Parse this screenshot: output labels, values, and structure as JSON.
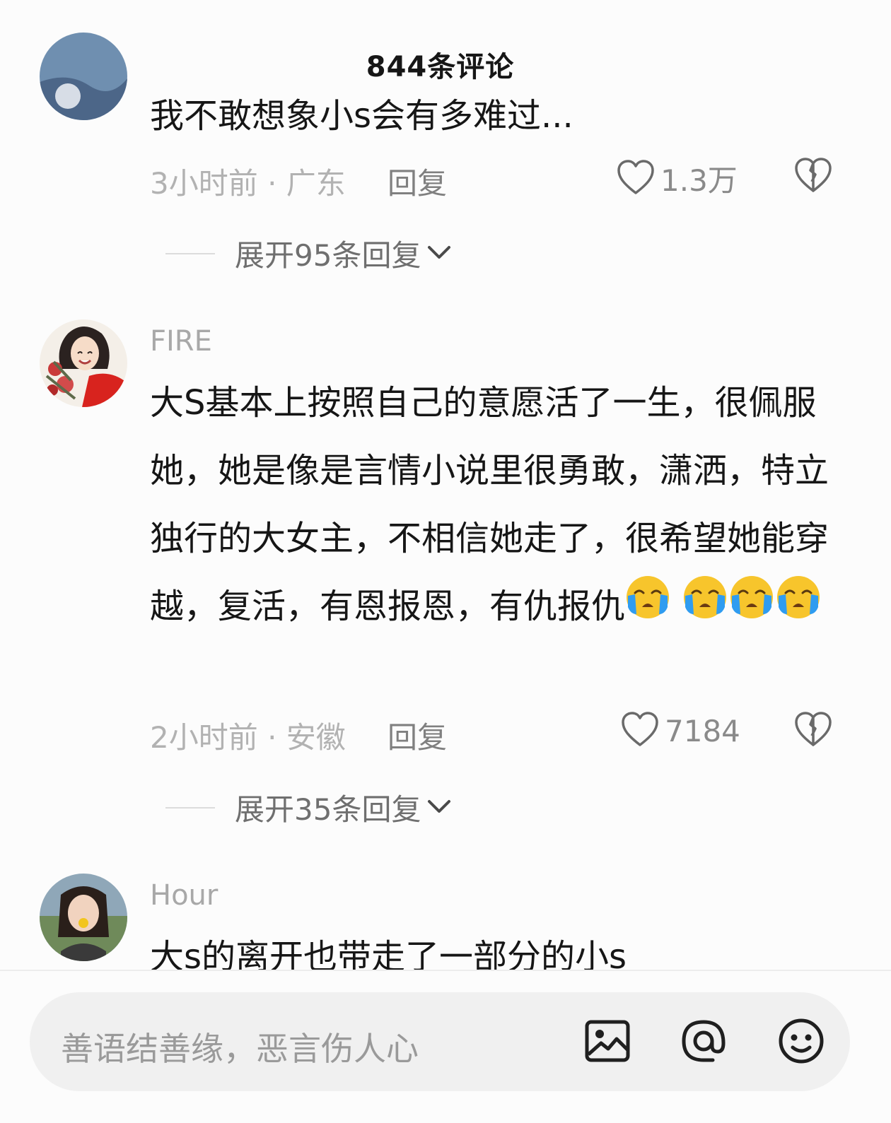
{
  "header": {
    "title": "844条评论"
  },
  "comments": [
    {
      "username": "",
      "text": "我不敢想象小s会有多难过...",
      "meta": "3小时前 · 广东",
      "reply_label": "回复",
      "likes": "1.3万",
      "expand_label": "展开95条回复"
    },
    {
      "username": "FIRE",
      "text": "大S基本上按照自己的意愿活了一生，很佩服她，她是像是言情小说里很勇敢，潇洒，特立独行的大女主，不相信她走了，很希望她能穿越，复活，有恩报恩，有仇报仇",
      "meta": "2小时前 · 安徽",
      "reply_label": "回复",
      "likes": "7184",
      "expand_label": "展开35条回复"
    },
    {
      "username": "Hour",
      "text": "大s的离开也带走了一部分的小s"
    }
  ],
  "icons": {
    "like": "heart-outline-icon",
    "dislike": "broken-heart-icon",
    "expand": "chevron-down-icon",
    "crying": "loudly-crying-face-emoji",
    "image": "image-icon",
    "mention": "at-sign-icon",
    "emoji": "smiley-face-icon"
  },
  "composer": {
    "placeholder": "善语结善缘，恶言伤人心"
  },
  "colors": {
    "background": "#fcfcfc",
    "muted": "#b2b2b2",
    "text": "#161616",
    "emoji_face": "#f7c52c",
    "emoji_tears": "#2f9cf0"
  }
}
